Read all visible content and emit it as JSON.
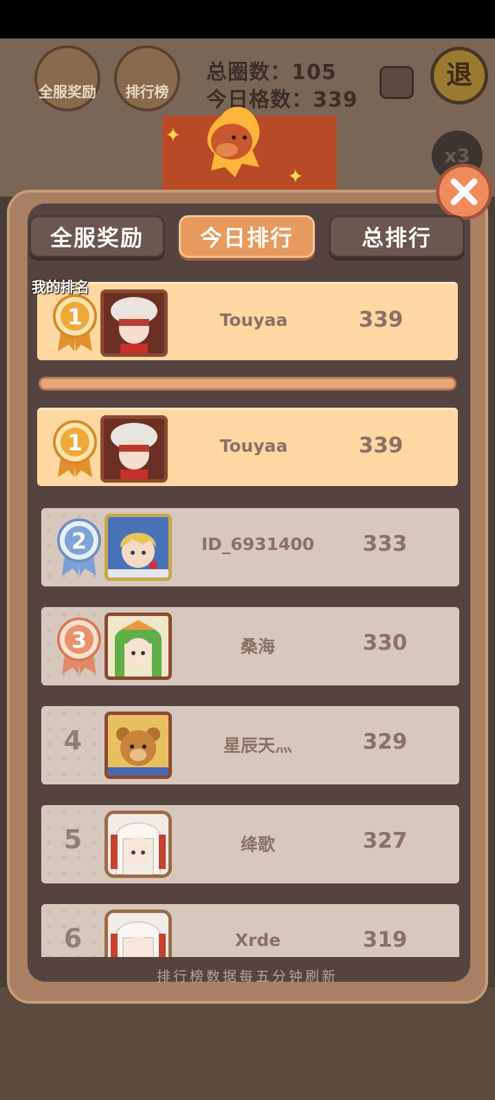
{
  "hud": {
    "left_buttons": [
      {
        "label": "全服奖励"
      },
      {
        "label": "排行榜"
      }
    ],
    "total_laps_label": "总圈数：",
    "total_laps_value": "105",
    "today_cells_label": "今日格数：",
    "today_cells_value": "339",
    "quit_label": "退",
    "multiplier_label": "x3"
  },
  "tabs": [
    {
      "label": "全服奖励",
      "active": false
    },
    {
      "label": "今日排行",
      "active": true
    },
    {
      "label": "总排行",
      "active": false
    }
  ],
  "my_rank": {
    "section_label": "我的排名",
    "rank": "1",
    "name": "Touyaa",
    "score": "339"
  },
  "leaderboard": [
    {
      "rank": "1",
      "name": "Touyaa",
      "score": "339",
      "medal": "gold"
    },
    {
      "rank": "2",
      "name": "ID_6931400",
      "score": "333",
      "medal": "silver"
    },
    {
      "rank": "3",
      "name": "桑海",
      "score": "330",
      "medal": "bronze"
    },
    {
      "rank": "4",
      "name": "星辰天灬",
      "score": "329",
      "medal": "none"
    },
    {
      "rank": "5",
      "name": "绛歌",
      "score": "327",
      "medal": "none"
    },
    {
      "rank": "6",
      "name": "Xrde",
      "score": "319",
      "medal": "none"
    }
  ],
  "footer_note": "排行榜数据每五分钟刷新",
  "colors": {
    "gold_row": "#ffd7a2",
    "plain_row": "#d7c8be",
    "active_tab": "#e69a5e",
    "panel": "#55433f",
    "close_button": "#ef8a5e"
  }
}
